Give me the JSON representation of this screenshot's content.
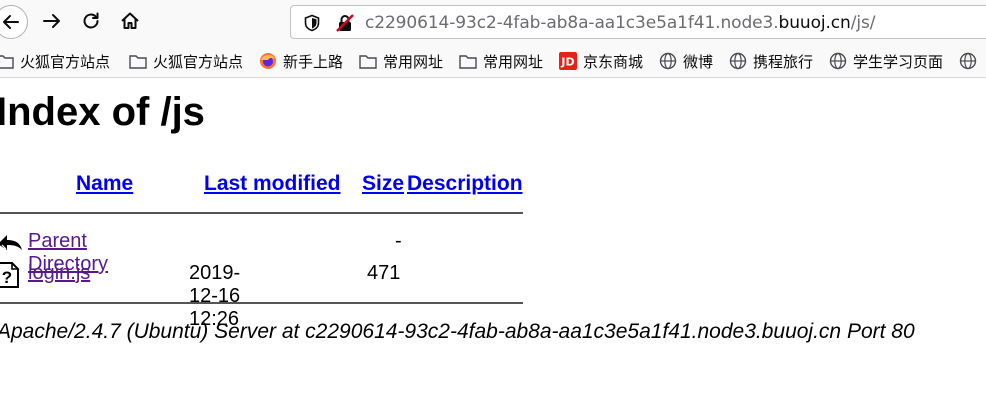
{
  "browser": {
    "url_host_prefix": "c2290614-93c2-4fab-ab8a-aa1c3e5a1f41.node3.",
    "url_host_domain": "buuoj.cn",
    "url_path": "/js/"
  },
  "bookmarks": [
    {
      "label": "火狐官方站点",
      "icon": "folder-icon"
    },
    {
      "label": "火狐官方站点",
      "icon": "folder-icon"
    },
    {
      "label": "新手上路",
      "icon": "firefox-icon"
    },
    {
      "label": "常用网址",
      "icon": "folder-icon"
    },
    {
      "label": "常用网址",
      "icon": "folder-icon"
    },
    {
      "label": "京东商城",
      "icon": "jd-icon"
    },
    {
      "label": "微博",
      "icon": "globe-icon"
    },
    {
      "label": "携程旅行",
      "icon": "globe-icon"
    },
    {
      "label": "学生学习页面",
      "icon": "globe-icon"
    }
  ],
  "page": {
    "title": "Index of /js",
    "columns": {
      "name": "Name",
      "last_modified": "Last modified",
      "size": "Size",
      "description": "Description"
    },
    "rows": [
      {
        "name": "Parent Directory",
        "modified": "",
        "size": "-",
        "icon": "back-arrow-icon"
      },
      {
        "name": "login.js",
        "modified": "2019-12-16 12:26",
        "size": "471",
        "icon": "unknown-file-icon"
      }
    ],
    "address": "Apache/2.4.7 (Ubuntu) Server at c2290614-93c2-4fab-ab8a-aa1c3e5a1f41.node3.buuoj.cn Port 80"
  },
  "colors": {
    "link": "#0000ee",
    "visited_link": "#551a8b",
    "toolbar_bg": "#f9f9fa"
  }
}
